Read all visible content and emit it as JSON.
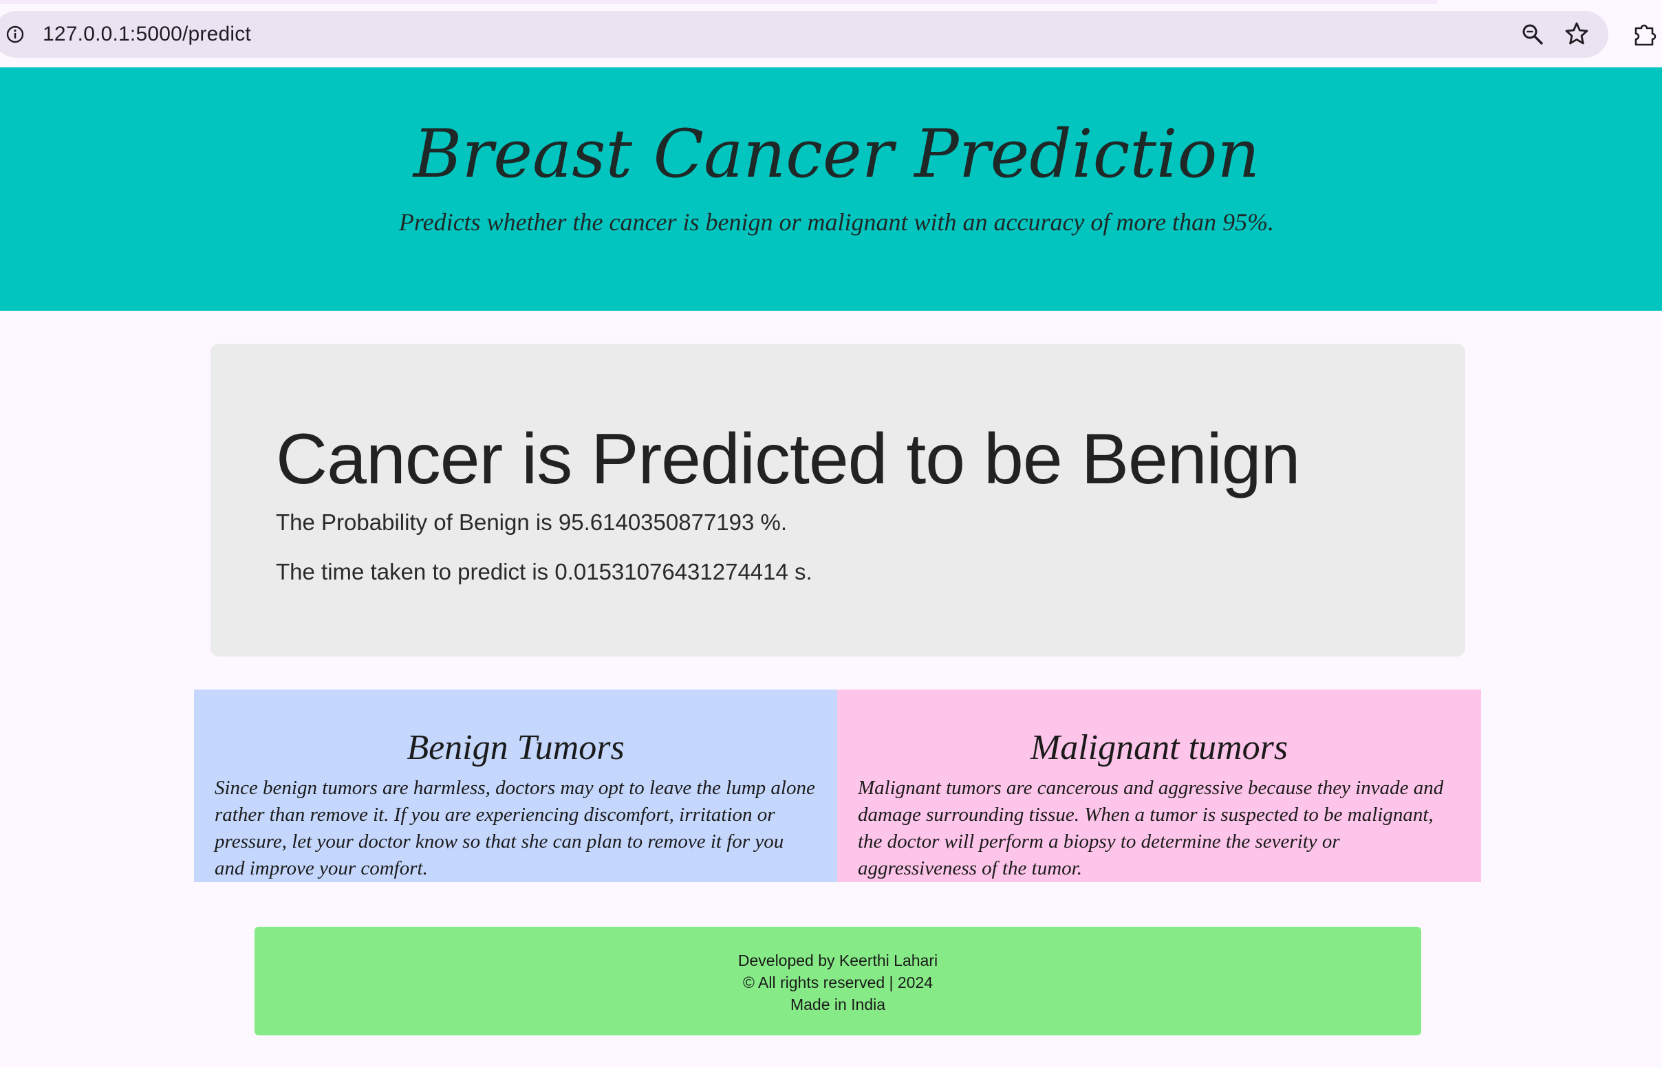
{
  "browser": {
    "url": "127.0.0.1:5000/predict",
    "icons": [
      "info-icon",
      "zoom-icon",
      "bookmark-star-icon",
      "extensions-icon"
    ]
  },
  "header": {
    "title": "Breast Cancer Prediction",
    "subtitle": "Predicts whether the cancer is benign or malignant with an accuracy of more than 95%."
  },
  "result": {
    "heading": "Cancer is Predicted to be Benign",
    "probability_text": "The Probability of Benign is 95.6140350877193 %.",
    "time_text": "The time taken to predict is 0.01531076431274414 s."
  },
  "info_boxes": [
    {
      "title": "Benign Tumors",
      "text": "Since benign tumors are harmless, doctors may opt to leave the lump alone rather than remove it. If you are experiencing discomfort, irritation or pressure, let your doctor know so that she can plan to remove it for you and improve your comfort."
    },
    {
      "title": "Malignant tumors",
      "text": "Malignant tumors are cancerous and aggressive because they invade and damage surrounding tissue. When a tumor is suspected to be malignant, the doctor will perform a biopsy to determine the severity or aggressiveness of the tumor."
    }
  ],
  "footer": {
    "line1": "Developed by Keerthi Lahari",
    "line2": "© All rights reserved | 2024",
    "line3": "Made in India"
  },
  "colors": {
    "header_bg": "#02c5c0",
    "result_bg": "#ebebeb",
    "benign_bg": "#c5d7fd",
    "malignant_bg": "#fdc5e9",
    "footer_bg": "#86eb86"
  }
}
